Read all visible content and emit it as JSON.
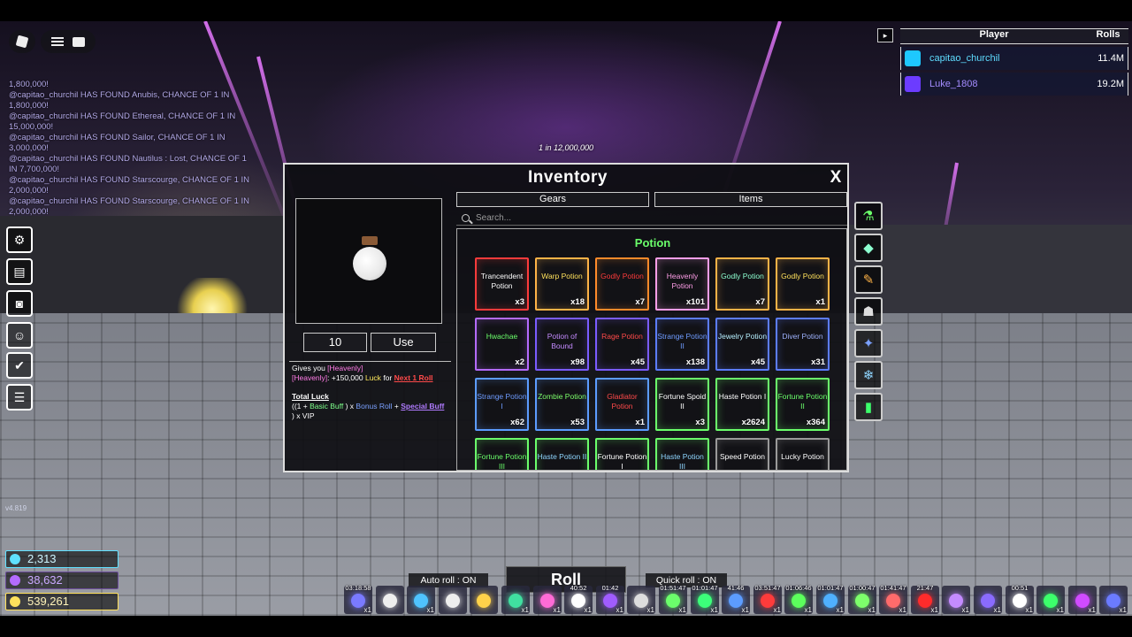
{
  "chat": {
    "messages": [
      "1,800,000!",
      "@capitao_churchil HAS FOUND Anubis, CHANCE OF 1 IN 1,800,000!",
      "@capitao_churchil HAS FOUND Ethereal, CHANCE OF 1 IN 15,000,000!",
      "@capitao_churchil HAS FOUND Sailor, CHANCE OF 1 IN 3,000,000!",
      "@capitao_churchil HAS FOUND Nautilus : Lost, CHANCE OF 1 IN 7,700,000!",
      "@capitao_churchil HAS FOUND Starscourge, CHANCE OF 1 IN 2,000,000!",
      "@capitao_churchil HAS FOUND Starscourge, CHANCE OF 1 IN 2,000,000!"
    ]
  },
  "leaderboard": {
    "col_player": "Player",
    "col_rolls": "Rolls",
    "rows": [
      {
        "name": "capitao_churchil",
        "rolls": "11.4M",
        "color": "#1ec8ff"
      },
      {
        "name": "Luke_1808",
        "rolls": "19.2M",
        "color": "#6c3cff"
      }
    ]
  },
  "rarity_text": "1 in 12,000,000",
  "inventory": {
    "title": "Inventory",
    "close": "X",
    "quantity": "10",
    "use_label": "Use",
    "tabs": [
      "Gears",
      "Items"
    ],
    "search_placeholder": "Search...",
    "section": "Potion",
    "desc": {
      "line1a": "Gives you",
      "line1b": "[Heavenly]",
      "line2a": "[Heavenly]",
      "line2b": ": +150,000",
      "line2c": "Luck",
      "line2d": "for",
      "line2e": "Next 1 Roll",
      "luck_title": "Total Luck",
      "f1": "((1 +",
      "f2": "Basic Buff",
      "f3": ") x",
      "f4": "Bonus Roll",
      "f5": "+",
      "f6": "Special Buff",
      "f7": ") x VIP"
    },
    "items": [
      {
        "name": "Trancendent Potion",
        "count": "x3",
        "text": "#ffffff",
        "border": "#ff3b3b"
      },
      {
        "name": "Warp Potion",
        "count": "x18",
        "text": "#ffe15c",
        "border": "#ffb347"
      },
      {
        "name": "Godly Potion",
        "count": "x7",
        "text": "#ff3b3b",
        "border": "#ff8a2a"
      },
      {
        "name": "Heavenly Potion",
        "count": "x101",
        "text": "#ff9ee8",
        "border": "#ff9ee8"
      },
      {
        "name": "Godly Potion",
        "count": "x7",
        "text": "#8dffd0",
        "border": "#ffb347"
      },
      {
        "name": "Godly Potion",
        "count": "x1",
        "text": "#ffe15c",
        "border": "#ffb347"
      },
      {
        "name": "Hwachae",
        "count": "x2",
        "text": "#6bff6b",
        "border": "#b46bff"
      },
      {
        "name": "Potion of Bound",
        "count": "x98",
        "text": "#c48bff",
        "border": "#7a5cff"
      },
      {
        "name": "Rage Potion",
        "count": "x45",
        "text": "#ff4a4a",
        "border": "#7a5cff"
      },
      {
        "name": "Strange Potion II",
        "count": "x138",
        "text": "#6f9cff",
        "border": "#5c7cff"
      },
      {
        "name": "Jewelry Potion",
        "count": "x45",
        "text": "#b7f0ff",
        "border": "#5c7cff"
      },
      {
        "name": "Diver Potion",
        "count": "x31",
        "text": "#9fb3ff",
        "border": "#5c7cff"
      },
      {
        "name": "Strange Potion I",
        "count": "x62",
        "text": "#6f9cff",
        "border": "#5c9cff"
      },
      {
        "name": "Zombie Potion",
        "count": "x53",
        "text": "#7dff6b",
        "border": "#5c9cff"
      },
      {
        "name": "Gladiator Potion",
        "count": "x1",
        "text": "#ff4a4a",
        "border": "#5c9cff"
      },
      {
        "name": "Fortune Spoid II",
        "count": "x3",
        "text": "#ffffff",
        "border": "#6bff6b"
      },
      {
        "name": "Haste Potion I",
        "count": "x2624",
        "text": "#ffffff",
        "border": "#6bff6b"
      },
      {
        "name": "Fortune Potion II",
        "count": "x364",
        "text": "#6bff6b",
        "border": "#6bff6b"
      },
      {
        "name": "Fortune Potion III",
        "count": "",
        "text": "#6bff6b",
        "border": "#6bff6b"
      },
      {
        "name": "Haste Potion II",
        "count": "",
        "text": "#8fd6ff",
        "border": "#6bff6b"
      },
      {
        "name": "Fortune Potion I",
        "count": "",
        "text": "#ffffff",
        "border": "#6bff6b"
      },
      {
        "name": "Haste Potion III",
        "count": "",
        "text": "#8fd6ff",
        "border": "#6bff6b"
      },
      {
        "name": "Speed Potion",
        "count": "",
        "text": "#ffffff",
        "border": "#9a9a9a"
      },
      {
        "name": "Lucky Potion",
        "count": "",
        "text": "#ffffff",
        "border": "#9a9a9a"
      }
    ],
    "categories": [
      "potion-icon",
      "crystal-icon",
      "scroll-icon",
      "ghost-icon",
      "star-icon",
      "snowflake-icon",
      "battery-icon"
    ]
  },
  "version": "v4.819",
  "currency": [
    {
      "value": "2,313",
      "color": "#5fe0ff"
    },
    {
      "value": "38,632",
      "color": "#b46bff"
    },
    {
      "value": "539,261",
      "color": "#ffe15c"
    }
  ],
  "bottom": {
    "auto_roll": "Auto roll : ON",
    "roll": "Roll",
    "quick_roll": "Quick roll : ON"
  },
  "buffs": [
    {
      "time": "03:18:58",
      "count": "x1",
      "color": "#7a7aff"
    },
    {
      "time": "",
      "count": "",
      "color": "#eeeeee"
    },
    {
      "time": "",
      "count": "x1",
      "color": "#4fc3ff"
    },
    {
      "time": "",
      "count": "",
      "color": "#eeeeee"
    },
    {
      "time": "",
      "count": "",
      "color": "#ffd24a"
    },
    {
      "time": "",
      "count": "x1",
      "color": "#40e0a0"
    },
    {
      "time": "",
      "count": "x1",
      "color": "#ff6bd6"
    },
    {
      "time": "40:52",
      "count": "x1",
      "color": "#ffffff"
    },
    {
      "time": "01:42",
      "count": "x1",
      "color": "#a05cff"
    },
    {
      "time": "",
      "count": "x1",
      "color": "#dddddd"
    },
    {
      "time": "01:51:47",
      "count": "x1",
      "color": "#6bff6b"
    },
    {
      "time": "01:01:47",
      "count": "x1",
      "color": "#3cff7a"
    },
    {
      "time": "41:46",
      "count": "x1",
      "color": "#5c9cff"
    },
    {
      "time": "03:51:47",
      "count": "x1",
      "color": "#ff3b3b"
    },
    {
      "time": "01:06:46",
      "count": "x1",
      "color": "#5cff5c"
    },
    {
      "time": "01:01:47",
      "count": "x1",
      "color": "#4fb0ff"
    },
    {
      "time": "01:00:47",
      "count": "x1",
      "color": "#7dff6b"
    },
    {
      "time": "01:41:47",
      "count": "x1",
      "color": "#ff6b6b"
    },
    {
      "time": "21:47",
      "count": "x1",
      "color": "#ff2b2b"
    },
    {
      "time": "",
      "count": "x1",
      "color": "#c48bff"
    },
    {
      "time": "",
      "count": "x1",
      "color": "#8a6bff"
    },
    {
      "time": "00:51",
      "count": "x1",
      "color": "#ffffff"
    },
    {
      "time": "",
      "count": "x1",
      "color": "#3cff6b"
    },
    {
      "time": "",
      "count": "x1",
      "color": "#d04bff"
    },
    {
      "time": "",
      "count": "x1",
      "color": "#6b7bff"
    }
  ]
}
